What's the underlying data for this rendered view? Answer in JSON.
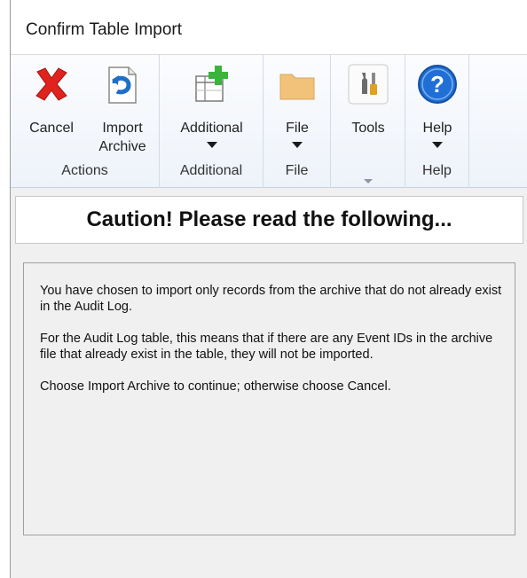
{
  "window": {
    "title": "Confirm Table Import"
  },
  "ribbon": {
    "actions": {
      "cancel": "Cancel",
      "import_line1": "Import",
      "import_line2": "Archive",
      "group": "Actions"
    },
    "additional": {
      "button": "Additional",
      "group": "Additional"
    },
    "file": {
      "button": "File",
      "group": "File"
    },
    "tools": {
      "button": "Tools"
    },
    "help": {
      "button": "Help",
      "group": "Help"
    },
    "colors": {
      "cancel_red": "#e0231e",
      "help_blue": "#1f6fd6",
      "folder": "#f2c27b",
      "plus_green": "#3cb43c"
    }
  },
  "caution": {
    "heading": "Caution! Please read the following..."
  },
  "message": {
    "p1": "You have chosen to import only records from the archive that do not already exist in the Audit Log.",
    "p2": "For the Audit Log table, this means that if there are any Event IDs in the archive file that already exist in the table, they will not be imported.",
    "p3": "Choose Import Archive to continue; otherwise choose Cancel."
  }
}
